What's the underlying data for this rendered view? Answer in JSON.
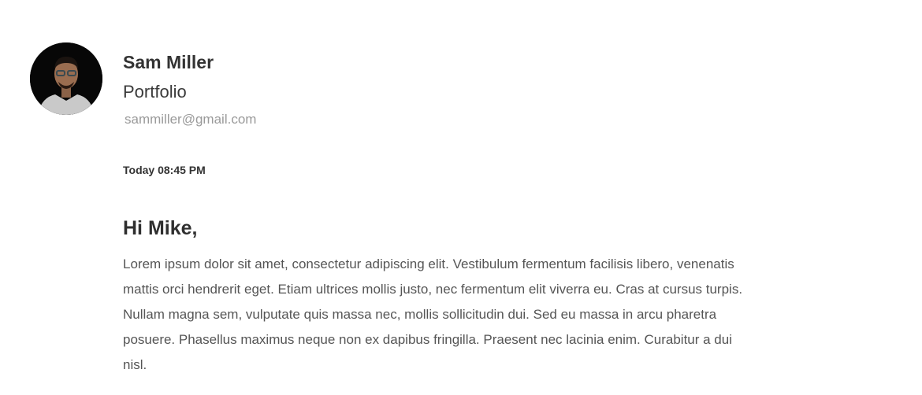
{
  "sender": {
    "name": "Sam Miller",
    "subtitle": "Portfolio",
    "email": "sammiller@gmail.com",
    "avatar_icon": "profile-photo"
  },
  "message": {
    "timestamp": "Today 08:45 PM",
    "greeting": "Hi Mike,",
    "body": "Lorem ipsum dolor sit amet, consectetur adipiscing elit. Vestibulum fermentum facilisis libero, venenatis mattis orci hendrerit eget. Etiam ultrices mollis justo, nec fermentum elit viverra eu. Cras at cursus turpis. Nullam magna sem, vulputate quis massa nec, mollis sollicitudin dui. Sed eu massa in arcu pharetra posuere. Phasellus maximus neque non ex dapibus fringilla. Praesent nec lacinia enim. Curabitur a dui nisl."
  }
}
